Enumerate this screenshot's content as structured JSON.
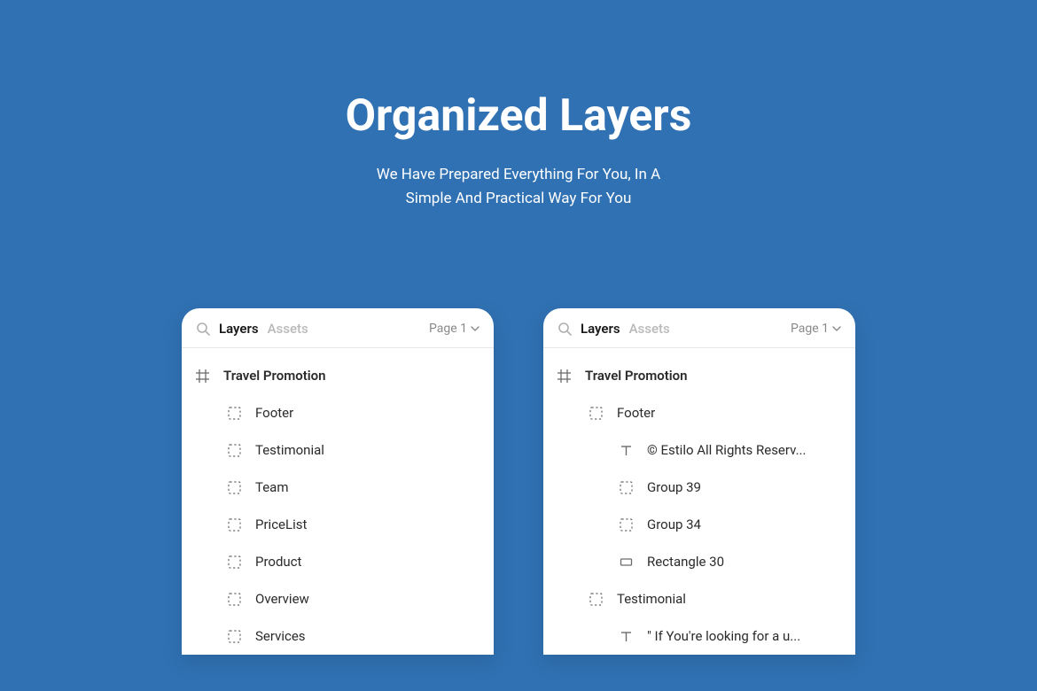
{
  "hero": {
    "title": "Organized Layers",
    "subtitle_line1": "We Have Prepared Everything For You, In A",
    "subtitle_line2": "Simple And Practical Way For You"
  },
  "panel_left": {
    "tabs": {
      "layers": "Layers",
      "assets": "Assets"
    },
    "page_selector": "Page 1",
    "root": "Travel Promotion",
    "items": [
      {
        "label": "Footer"
      },
      {
        "label": "Testimonial"
      },
      {
        "label": "Team"
      },
      {
        "label": "PriceList"
      },
      {
        "label": "Product"
      },
      {
        "label": "Overview"
      },
      {
        "label": "Services"
      }
    ]
  },
  "panel_right": {
    "tabs": {
      "layers": "Layers",
      "assets": "Assets"
    },
    "page_selector": "Page 1",
    "root": "Travel Promotion",
    "items": [
      {
        "icon": "group",
        "depth": 1,
        "label": "Footer"
      },
      {
        "icon": "text",
        "depth": 2,
        "label": "© Estilo All Rights Reserv..."
      },
      {
        "icon": "group",
        "depth": 2,
        "label": "Group 39"
      },
      {
        "icon": "group",
        "depth": 2,
        "label": "Group 34"
      },
      {
        "icon": "rect",
        "depth": 2,
        "label": "Rectangle 30"
      },
      {
        "icon": "group",
        "depth": 1,
        "label": "Testimonial"
      },
      {
        "icon": "text",
        "depth": 2,
        "label": "\" If You're looking for a u..."
      }
    ]
  }
}
